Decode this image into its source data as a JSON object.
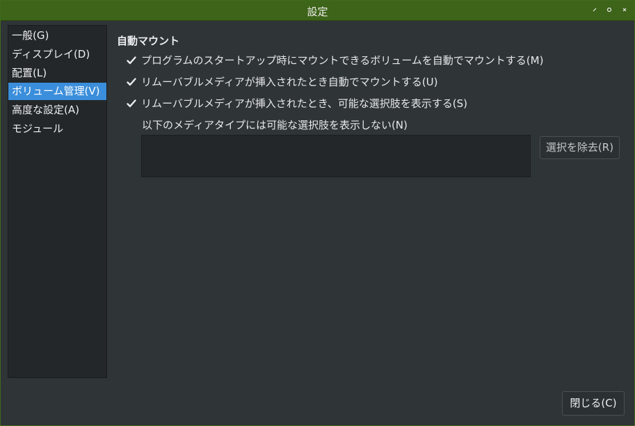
{
  "window": {
    "title": "設定"
  },
  "sidebar": {
    "items": [
      {
        "label": "一般(G)"
      },
      {
        "label": "ディスプレイ(D)"
      },
      {
        "label": "配置(L)"
      },
      {
        "label": "ボリューム管理(V)"
      },
      {
        "label": "高度な設定(A)"
      },
      {
        "label": "モジュール"
      }
    ],
    "selected": "ボリューム管理(V)"
  },
  "main": {
    "section_title": "自動マウント",
    "options": [
      {
        "label": "プログラムのスタートアップ時にマウントできるボリュームを自動でマウントする(M)",
        "checked": true
      },
      {
        "label": "リムーバブルメディアが挿入されたとき自動でマウントする(U)",
        "checked": true
      },
      {
        "label": "リムーバブルメディアが挿入されたとき、可能な選択肢を表示する(S)",
        "checked": true
      }
    ],
    "media_list_label": "以下のメディアタイプには可能な選択肢を表示しない(N)",
    "remove_button": "選択を除去(R)"
  },
  "footer": {
    "close_button": "閉じる(C)"
  },
  "colors": {
    "titlebar": "#3d6419",
    "accent": "#3b8edb",
    "background": "#2f3437"
  },
  "icons": {
    "minimize": "minimize-icon",
    "maximize": "maximize-icon",
    "close": "close-icon",
    "checkbox": "check-icon"
  }
}
